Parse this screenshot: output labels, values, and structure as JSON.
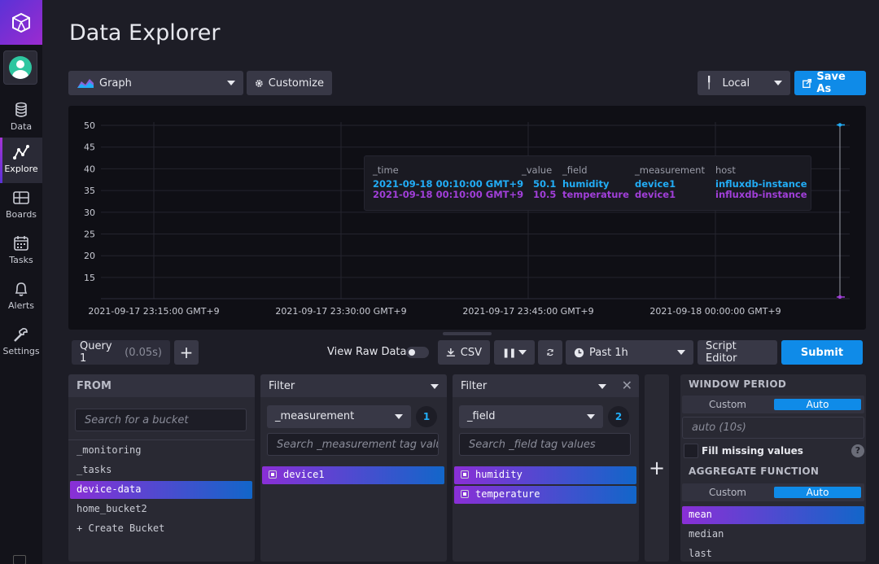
{
  "sidebar": {
    "items": [
      {
        "label": "Data",
        "icon": "database-icon"
      },
      {
        "label": "Explore",
        "icon": "graph-icon"
      },
      {
        "label": "Boards",
        "icon": "dashboard-icon"
      },
      {
        "label": "Tasks",
        "icon": "calendar-icon"
      },
      {
        "label": "Alerts",
        "icon": "bell-icon"
      },
      {
        "label": "Settings",
        "icon": "wrench-icon"
      }
    ],
    "active": "Explore"
  },
  "header": {
    "title": "Data Explorer",
    "graph_type": "Graph",
    "customize_label": "Customize",
    "timezone": "Local",
    "save_as_label": "Save As"
  },
  "chart_data": {
    "type": "line",
    "y_ticks": [
      "50",
      "45",
      "40",
      "35",
      "30",
      "25",
      "20",
      "15"
    ],
    "x_ticks": [
      "2021-09-17 23:15:00 GMT+9",
      "2021-09-17 23:30:00 GMT+9",
      "2021-09-17 23:45:00 GMT+9",
      "2021-09-18 00:00:00 GMT+9"
    ],
    "series": [
      {
        "name": "humidity",
        "color": "#22adf6",
        "values": [
          {
            "x": "2021-09-18 00:10:00 GMT+9",
            "y": 50.1
          }
        ]
      },
      {
        "name": "temperature",
        "color": "#a13fd9",
        "values": [
          {
            "x": "2021-09-18 00:10:00 GMT+9",
            "y": 10.5
          }
        ]
      }
    ],
    "tooltip": {
      "headers": [
        "_time",
        "_value",
        "_field",
        "_measurement",
        "host"
      ],
      "rows": [
        {
          "time": "2021-09-18 00:10:00 GMT+9",
          "value": "50.1",
          "field": "humidity",
          "measurement": "device1",
          "host": "influxdb-instance"
        },
        {
          "time": "2021-09-18 00:10:00 GMT+9",
          "value": "10.5",
          "field": "temperature",
          "measurement": "device1",
          "host": "influxdb-instance"
        }
      ]
    }
  },
  "query_bar": {
    "tab_name": "Query 1",
    "tab_time": "(0.05s)",
    "add_label": "+",
    "raw_data_label": "View Raw Data",
    "csv_label": "CSV",
    "time_range": "Past 1h",
    "script_editor_label": "Script Editor",
    "submit_label": "Submit"
  },
  "from_panel": {
    "title": "FROM",
    "search_placeholder": "Search for a bucket",
    "buckets": [
      "_monitoring",
      "_tasks",
      "device-data",
      "home_bucket2",
      "+ Create Bucket"
    ],
    "selected": "device-data"
  },
  "filter1": {
    "title": "Filter",
    "key": "_measurement",
    "count": "1",
    "search_placeholder": "Search _measurement tag values",
    "values": [
      "device1"
    ]
  },
  "filter2": {
    "title": "Filter",
    "key": "_field",
    "count": "2",
    "search_placeholder": "Search _field tag values",
    "values": [
      "humidity",
      "temperature"
    ]
  },
  "window_panel": {
    "window_title": "WINDOW PERIOD",
    "custom_label": "Custom",
    "auto_label": "Auto",
    "window_value": "auto (10s)",
    "fill_label": "Fill missing values",
    "help": "?",
    "aggregate_title": "AGGREGATE FUNCTION",
    "functions": [
      "mean",
      "median",
      "last"
    ],
    "selected_function": "mean"
  },
  "colors": {
    "accent_blue": "#0f8be8",
    "humidity": "#22adf6",
    "temperature": "#a13fd9"
  }
}
